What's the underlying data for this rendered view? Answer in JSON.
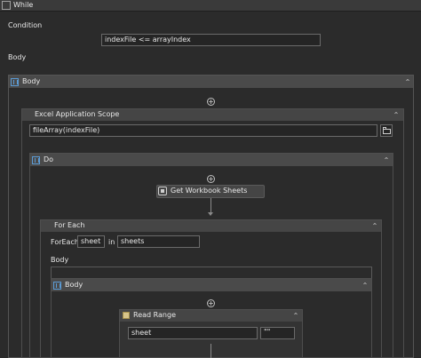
{
  "while": {
    "title": "While",
    "condition_label": "Condition",
    "condition_value": "indexFile <= arrayIndex",
    "body_label": "Body"
  },
  "body_sequence": {
    "title": "Body"
  },
  "excel_scope": {
    "title": "Excel Application Scope",
    "path_value": "fileArray(indexFile)"
  },
  "do_sequence": {
    "title": "Do"
  },
  "get_sheets": {
    "title": "Get Workbook Sheets"
  },
  "for_each": {
    "title": "For Each",
    "foreach_label": "ForEach",
    "item_value": "sheet",
    "in_label": "in",
    "collection_value": "sheets",
    "body_label": "Body"
  },
  "inner_body": {
    "title": "Body"
  },
  "read_range": {
    "title": "Read Range",
    "sheet_value": "sheet",
    "range_value": "\"\""
  },
  "icons": {
    "collapse": "⌃",
    "plus": "+"
  }
}
